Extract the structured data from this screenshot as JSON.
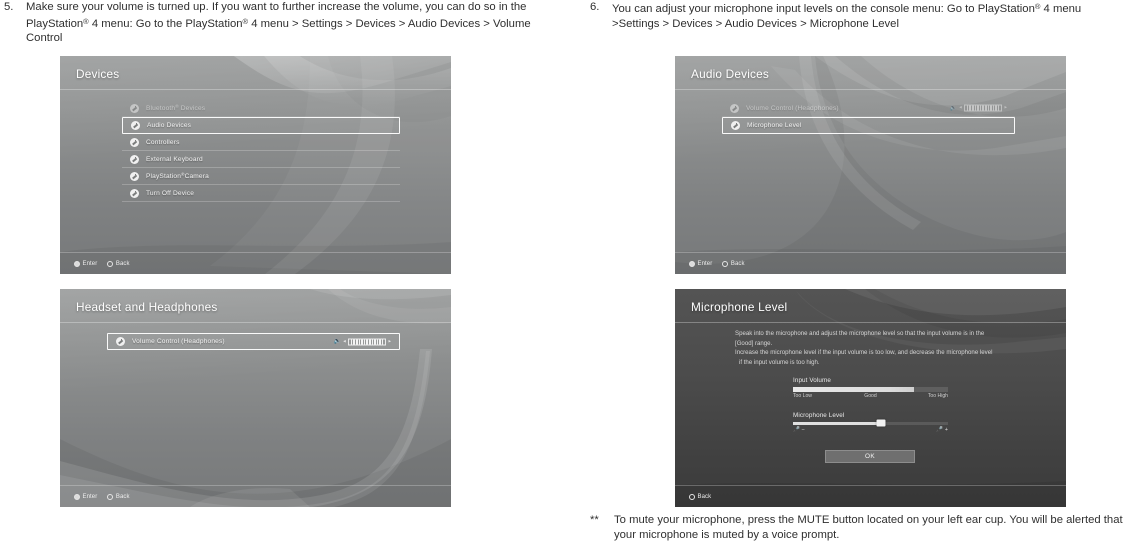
{
  "steps": [
    {
      "number": "5.",
      "text_html": "Make sure your volume is turned up. If you want to further increase the volume, you can do so in the PlayStation<sup>®</sup> 4 menu: Go to the PlayStation<sup>®</sup> 4 menu > Settings > Devices > Audio Devices > Volume Control",
      "text": "Make sure your volume is turned up. If you want to further increase the volume, you can do so in the PlayStation® 4 menu: Go to the PlayStation® 4 menu > Settings > Devices > Audio Devices > Volume Control"
    },
    {
      "number": "6.",
      "text_html": "You can adjust your microphone input levels on the console menu: Go to PlayStation<sup>®</sup> 4 menu >Settings > Devices > Audio Devices > Microphone Level",
      "text": "You can adjust your microphone input levels on the console menu: Go to PlayStation® 4 menu >Settings > Devices > Audio Devices > Microphone Level"
    }
  ],
  "footnote": {
    "marker": "**",
    "text": "To mute your microphone, press the MUTE button located on your left ear cup. You will be alerted that your microphone is muted by a voice prompt."
  },
  "screens": {
    "devices": {
      "title": "Devices",
      "items": [
        {
          "label": "Bluetooth® Devices",
          "label_html": "Bluetooth<sup>®</sup> Devices",
          "selected": false,
          "dim": true
        },
        {
          "label": "Audio Devices",
          "label_html": "Audio Devices",
          "selected": true,
          "dim": false
        },
        {
          "label": "Controllers",
          "label_html": "Controllers",
          "selected": false,
          "dim": false
        },
        {
          "label": "External Keyboard",
          "label_html": "External Keyboard",
          "selected": false,
          "dim": false
        },
        {
          "label": "PlayStation®Camera",
          "label_html": "PlayStation<sup>®</sup>Camera",
          "selected": false,
          "dim": false
        },
        {
          "label": "Turn Off Device",
          "label_html": "Turn Off Device",
          "selected": false,
          "dim": false
        }
      ],
      "footer": [
        {
          "label": "Enter",
          "glyph": "circle-filled"
        },
        {
          "label": "Back",
          "glyph": "circle-outline"
        }
      ]
    },
    "headset_and_headphones": {
      "title": "Headset and Headphones",
      "items": [
        {
          "label": "Volume Control (Headphones)",
          "selected": true,
          "dim": false,
          "volume": {
            "segments": 13,
            "filled": 13,
            "speaker_icon": "speaker-icon",
            "left_arrow": "◂",
            "right_arrow": "▸"
          }
        }
      ],
      "footer": [
        {
          "label": "Enter",
          "glyph": "circle-filled"
        },
        {
          "label": "Back",
          "glyph": "circle-outline"
        }
      ]
    },
    "audio_devices": {
      "title": "Audio Devices",
      "items": [
        {
          "label": "Volume Control (Headphones)",
          "selected": false,
          "dim": true,
          "volume": {
            "segments": 13,
            "filled": 13,
            "speaker_icon": "speaker-icon",
            "left_arrow": "◂",
            "right_arrow": "▸"
          }
        },
        {
          "label": "Microphone Level",
          "selected": true,
          "dim": false
        }
      ],
      "footer": [
        {
          "label": "Enter",
          "glyph": "circle-filled"
        },
        {
          "label": "Back",
          "glyph": "circle-outline"
        }
      ]
    },
    "microphone_level": {
      "title": "Microphone Level",
      "description_lines": [
        "Speak into the microphone and adjust the microphone level so that the input volume is in the",
        "[Good] range.",
        "Increase the microphone level if the input volume is too low, and decrease the microphone level",
        "if the input volume is too high."
      ],
      "input_volume": {
        "label": "Input Volume",
        "fill_percent": 78,
        "scale": {
          "low": "Too Low",
          "good": "Good",
          "high": "Too High"
        }
      },
      "microphone_level": {
        "label": "Microphone Level",
        "value_percent": 57,
        "left_icon": "mic-minus-icon",
        "left_glyph": " −",
        "right_icon": "mic-plus-icon",
        "right_glyph": " +"
      },
      "ok_button": "OK",
      "footer": [
        {
          "label": "Back",
          "glyph": "circle-outline"
        }
      ]
    }
  },
  "colors": {
    "page_background": "#ffffff",
    "text": "#2f2f2f",
    "panel_light": "#8b8d8d",
    "panel_dark": "#4a4a4a",
    "highlight_border": "#ffffff",
    "meter_fill": "#e9e9e9"
  }
}
